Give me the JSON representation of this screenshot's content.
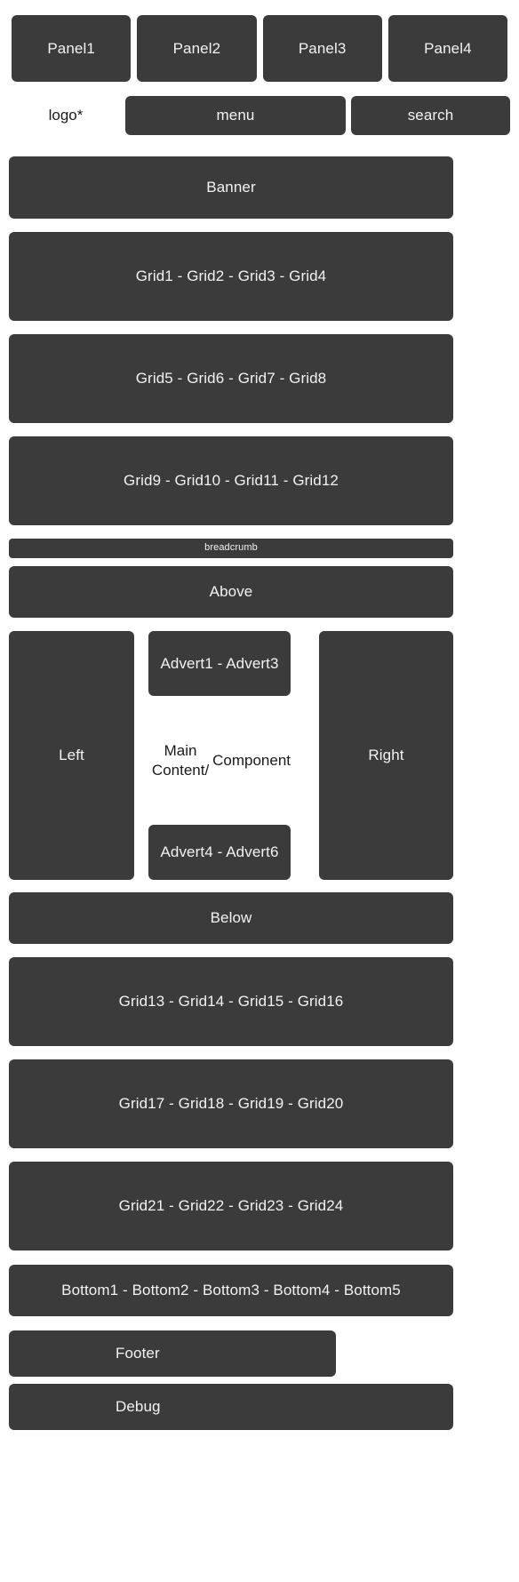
{
  "theme": {
    "block_bg": "#3b3b3b",
    "block_text": "#f2f2f2",
    "page_bg": "#ffffff",
    "plain_text": "#1a1a1a"
  },
  "panels": {
    "items": [
      {
        "label": "Panel1"
      },
      {
        "label": "Panel2"
      },
      {
        "label": "Panel3"
      },
      {
        "label": "Panel4"
      }
    ]
  },
  "topbar": {
    "logo": "logo*",
    "menu": "menu",
    "search": "search"
  },
  "banner": {
    "label": "Banner"
  },
  "grid_rows_top": [
    {
      "label": "Grid1 - Grid2 - Grid3 - Grid4"
    },
    {
      "label": "Grid5 - Grid6 - Grid7 - Grid8"
    },
    {
      "label": "Grid9 - Grid10 - Grid11 - Grid12"
    }
  ],
  "breadcrumb": {
    "label": "breadcrumb"
  },
  "above": {
    "label": "Above"
  },
  "main": {
    "left": "Left",
    "right": "Right",
    "advert_top": "Advert1 - Advert3",
    "content": "Main Content/\nComponent",
    "content_line1": "Main Content/",
    "content_line2": "Component",
    "advert_bottom": "Advert4 - Advert6"
  },
  "below": {
    "label": "Below"
  },
  "grid_rows_bottom": [
    {
      "label": "Grid13 - Grid14 - Grid15 - Grid16"
    },
    {
      "label": "Grid17 - Grid18 - Grid19 - Grid20"
    },
    {
      "label": "Grid21 - Grid22 - Grid23 - Grid24"
    }
  ],
  "bottom": {
    "label": "Bottom1 - Bottom2 - Bottom3 - Bottom4 - Bottom5"
  },
  "footer": {
    "label": "Footer"
  },
  "debug": {
    "label": "Debug"
  }
}
